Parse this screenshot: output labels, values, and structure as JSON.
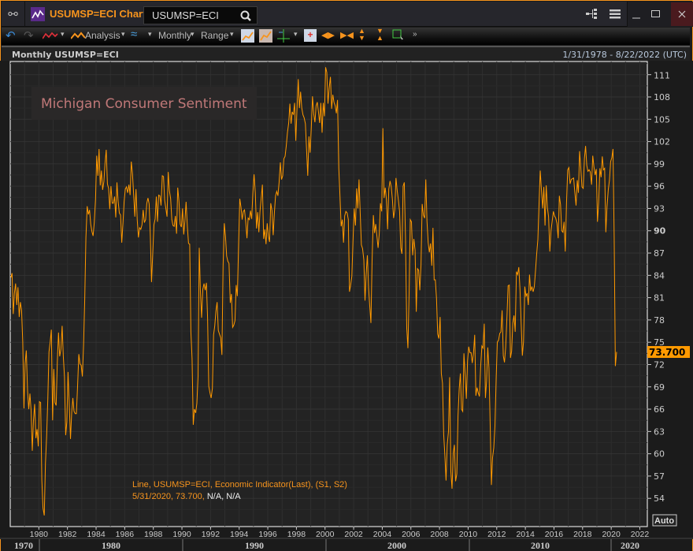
{
  "window": {
    "title": "USUMSP=ECI Chart",
    "search_value": "USUMSP=ECI"
  },
  "toolbar": {
    "analysis": "Analysis",
    "frequency": "Monthly",
    "range": "Range"
  },
  "header": {
    "series_label": "Monthly USUMSP=ECI",
    "date_range": "1/31/1978 - 8/22/2022 (UTC)"
  },
  "annotation": {
    "text": "Michigan Consumer Sentiment"
  },
  "legend": {
    "line1": "Line, USUMSP=ECI, Economic Indicator(Last), (S1, S2)",
    "line2_a": "5/31/2020, 73.700,",
    "line2_b": "N/A, N/A"
  },
  "price_tag": "73.700",
  "auto_label": "Auto",
  "colors": {
    "accent": "#f7941d",
    "line": "#ff9900",
    "close_bg": "#4a1a1e",
    "annotation": "#c07878"
  },
  "chart_data": {
    "type": "line",
    "title": "Michigan Consumer Sentiment",
    "series_name": "USUMSP=ECI",
    "x_start": "1978-01",
    "frequency": "monthly",
    "yticks": [
      111,
      108,
      105,
      102,
      99,
      96,
      93,
      90,
      87,
      84,
      81,
      78,
      75,
      72,
      69,
      66,
      63,
      60,
      57,
      54
    ],
    "xticks": [
      "1980",
      "1982",
      "1984",
      "1986",
      "1988",
      "1990",
      "1992",
      "1994",
      "1996",
      "1998",
      "2000",
      "2002",
      "2004",
      "2006",
      "2008",
      "2010",
      "2012",
      "2014",
      "2016",
      "2018",
      "2020",
      "2022"
    ],
    "decades": [
      "1970",
      "1980",
      "1990",
      "2000",
      "2010",
      "2020"
    ],
    "xlim": [
      1978.0,
      2022.5
    ],
    "ylim": [
      52,
      113.5
    ],
    "values": [
      83.7,
      84.3,
      78.8,
      81.6,
      82.9,
      80.0,
      82.4,
      78.4,
      80.4,
      79.3,
      75.0,
      66.1,
      72.1,
      73.9,
      68.4,
      66.0,
      68.1,
      65.8,
      60.4,
      64.5,
      66.7,
      62.1,
      63.3,
      61.0,
      67.0,
      66.9,
      56.5,
      52.7,
      51.7,
      58.7,
      62.3,
      67.3,
      73.7,
      75.0,
      76.7,
      64.5,
      71.4,
      66.9,
      66.5,
      72.4,
      76.3,
      73.1,
      74.1,
      77.2,
      73.1,
      70.3,
      62.5,
      64.3,
      71.0,
      66.5,
      62.0,
      65.5,
      67.5,
      65.7,
      65.4,
      65.4,
      69.3,
      73.4,
      72.1,
      71.9,
      70.4,
      74.6,
      80.8,
      89.1,
      93.3,
      92.2,
      92.8,
      90.9,
      89.9,
      89.3,
      91.1,
      94.2,
      100.1,
      97.4,
      101.0,
      96.1,
      98.1,
      95.5,
      96.6,
      99.1,
      100.9,
      96.3,
      95.7,
      92.9,
      96.0,
      93.7,
      93.7,
      94.6,
      91.8,
      96.5,
      94.0,
      92.4,
      92.1,
      88.4,
      90.9,
      93.9,
      95.6,
      95.9,
      95.1,
      96.2,
      94.8,
      99.3,
      97.7,
      94.9,
      91.9,
      95.6,
      91.4,
      89.1,
      90.4,
      90.2,
      90.8,
      92.8,
      91.1,
      91.5,
      93.7,
      94.4,
      93.6,
      89.3,
      83.1,
      86.8,
      90.8,
      91.6,
      94.6,
      91.2,
      94.8,
      94.7,
      93.4,
      97.4,
      97.3,
      94.1,
      93.0,
      91.9,
      97.9,
      95.4,
      94.3,
      91.5,
      90.7,
      90.6,
      92.0,
      89.6,
      95.8,
      93.9,
      90.9,
      90.5,
      93.0,
      89.5,
      91.3,
      93.9,
      90.6,
      88.3,
      88.2,
      76.4,
      72.8,
      63.9,
      66.0,
      65.5,
      66.8,
      70.4,
      87.7,
      81.8,
      78.3,
      82.1,
      82.9,
      82.0,
      83.0,
      78.3,
      69.1,
      68.2,
      67.5,
      68.8,
      76.0,
      77.2,
      79.2,
      80.4,
      76.6,
      76.1,
      75.6,
      73.3,
      85.3,
      91.0,
      89.3,
      86.6,
      85.9,
      85.6,
      80.3,
      81.5,
      77.0,
      77.3,
      77.9,
      82.7,
      81.2,
      88.2,
      94.3,
      93.2,
      91.5,
      92.6,
      92.8,
      91.2,
      89.0,
      91.7,
      91.5,
      92.7,
      91.6,
      95.1,
      97.6,
      95.1,
      90.3,
      92.5,
      89.8,
      92.7,
      94.4,
      96.2,
      88.9,
      90.2,
      88.2,
      91.0,
      89.3,
      88.5,
      93.7,
      92.7,
      89.4,
      92.4,
      94.7,
      95.3,
      94.7,
      96.5,
      99.2,
      96.9,
      97.4,
      99.7,
      100.0,
      101.4,
      103.2,
      104.5,
      107.1,
      104.4,
      106.0,
      105.6,
      107.2,
      102.1,
      106.6,
      110.4,
      106.5,
      108.7,
      106.5,
      105.6,
      105.2,
      104.4,
      100.9,
      97.4,
      102.7,
      100.5,
      103.9,
      108.1,
      105.7,
      104.6,
      106.8,
      107.3,
      106.0,
      104.5,
      107.2,
      103.2,
      107.2,
      105.4,
      112.0,
      111.3,
      107.1,
      109.2,
      110.7,
      106.4,
      108.3,
      107.3,
      106.8,
      105.8,
      107.6,
      98.4,
      94.7,
      90.6,
      91.5,
      88.4,
      92.0,
      92.6,
      92.4,
      91.5,
      81.8,
      82.7,
      83.9,
      88.8,
      93.0,
      90.7,
      95.7,
      93.0,
      96.9,
      92.4,
      88.1,
      87.6,
      86.1,
      80.6,
      84.2,
      86.7,
      82.4,
      79.9,
      77.6,
      86.0,
      92.1,
      89.7,
      90.9,
      89.3,
      87.7,
      89.6,
      93.7,
      92.6,
      103.8,
      94.4,
      95.8,
      94.2,
      90.2,
      95.6,
      96.7,
      95.9,
      94.2,
      91.7,
      92.8,
      97.1,
      95.5,
      94.1,
      92.6,
      87.7,
      86.9,
      96.0,
      96.5,
      89.1,
      76.9,
      74.2,
      81.6,
      91.5,
      91.2,
      86.7,
      88.9,
      87.4,
      79.1,
      84.9,
      84.7,
      82.0,
      85.4,
      93.6,
      92.1,
      91.7,
      96.9,
      91.3,
      88.4,
      87.1,
      88.3,
      85.3,
      90.4,
      83.4,
      83.4,
      80.9,
      76.1,
      75.5,
      78.4,
      70.8,
      69.5,
      62.6,
      59.8,
      56.4,
      61.2,
      63.0,
      70.3,
      57.6,
      55.3,
      60.1,
      61.2,
      56.3,
      57.3,
      65.1,
      68.7,
      70.8,
      66.0,
      65.7,
      73.5,
      70.6,
      67.4,
      72.5,
      74.4,
      73.6,
      73.6,
      72.2,
      73.6,
      76.0,
      67.8,
      68.9,
      68.2,
      67.7,
      71.6,
      74.5,
      74.2,
      77.5,
      67.5,
      69.8,
      74.3,
      71.5,
      63.7,
      55.8,
      59.5,
      60.8,
      63.7,
      69.9,
      75.0,
      75.3,
      76.2,
      76.4,
      79.3,
      73.2,
      72.3,
      74.3,
      78.3,
      82.6,
      82.7,
      72.9,
      73.8,
      77.6,
      78.6,
      76.4,
      84.5,
      84.1,
      85.1,
      82.1,
      77.5,
      73.2,
      75.1,
      82.5,
      81.2,
      81.6,
      80.0,
      84.1,
      81.9,
      82.5,
      81.8,
      82.5,
      84.6,
      86.9,
      88.8,
      93.6,
      98.1,
      95.4,
      93.0,
      95.9,
      90.7,
      96.1,
      93.1,
      91.9,
      87.2,
      90.0,
      91.3,
      92.6,
      92.0,
      91.7,
      91.0,
      89.0,
      94.7,
      93.5,
      90.0,
      89.8,
      91.2,
      87.2,
      93.8,
      98.2,
      98.5,
      96.3,
      96.9,
      97.0,
      97.1,
      95.1,
      93.4,
      96.8,
      95.1,
      100.7,
      98.5,
      95.9,
      95.7,
      99.7,
      101.4,
      98.8,
      98.0,
      98.2,
      97.9,
      96.2,
      100.1,
      98.6,
      97.5,
      98.3,
      91.2,
      93.8,
      98.4,
      97.2,
      100.0,
      98.2,
      98.4,
      89.8,
      93.2,
      95.5,
      96.8,
      99.3,
      99.8,
      101.0,
      89.1,
      71.8,
      73.7
    ]
  }
}
